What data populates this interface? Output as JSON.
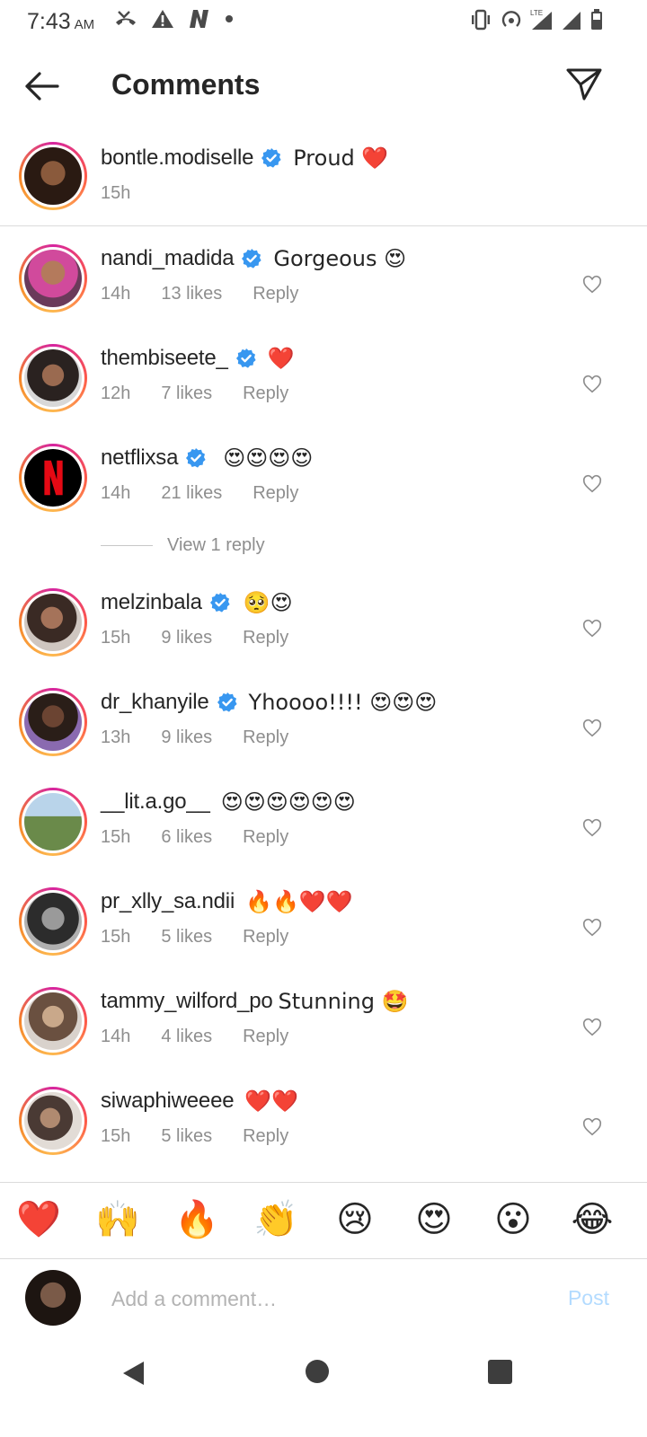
{
  "status_bar": {
    "time": "7:43",
    "ampm": "AM",
    "network": "LTE"
  },
  "header": {
    "title": "Comments"
  },
  "caption": {
    "username": "bontle.modiselle",
    "verified": true,
    "text": "Proud ❤️",
    "time": "15h"
  },
  "comments": [
    {
      "username": "nandi_madida",
      "verified": true,
      "text": "Gorgeous 😍",
      "time": "14h",
      "likes": "13 likes",
      "reply": "Reply"
    },
    {
      "username": "thembiseete_",
      "verified": true,
      "text": "❤️",
      "time": "12h",
      "likes": "7 likes",
      "reply": "Reply"
    },
    {
      "username": "netflixsa",
      "verified": true,
      "text": "😍😍😍😍",
      "time": "14h",
      "likes": "21 likes",
      "reply": "Reply"
    },
    {
      "username": "melzinbala",
      "verified": true,
      "text": "🥺😍",
      "time": "15h",
      "likes": "9 likes",
      "reply": "Reply"
    },
    {
      "username": "dr_khanyile",
      "verified": true,
      "text": "Yhoooo!!!! 😍😍😍",
      "time": "13h",
      "likes": "9 likes",
      "reply": "Reply"
    },
    {
      "username": "__lit.a.go__",
      "verified": false,
      "text": "😍😍😍😍😍😍",
      "time": "15h",
      "likes": "6 likes",
      "reply": "Reply"
    },
    {
      "username": "pr_xlly_sa.ndii",
      "verified": false,
      "text": "🔥🔥❤️❤️",
      "time": "15h",
      "likes": "5 likes",
      "reply": "Reply"
    },
    {
      "username": "tammy_wilford_po",
      "verified": false,
      "text": "Stunning 🤩",
      "time": "14h",
      "likes": "4 likes",
      "reply": "Reply"
    },
    {
      "username": "siwaphiweeee",
      "verified": false,
      "text": "❤️❤️",
      "time": "15h",
      "likes": "5 likes",
      "reply": "Reply"
    }
  ],
  "view_replies": "View 1 reply",
  "quick_emojis": [
    "❤️",
    "🙌",
    "🔥",
    "👏",
    "😢",
    "😍",
    "😮",
    "😂"
  ],
  "composer": {
    "placeholder": "Add a comment…",
    "post_label": "Post"
  },
  "colors": {
    "verified_blue": "#3897f0",
    "post_disabled": "#b3dbff",
    "meta_gray": "#8e8e8e"
  }
}
